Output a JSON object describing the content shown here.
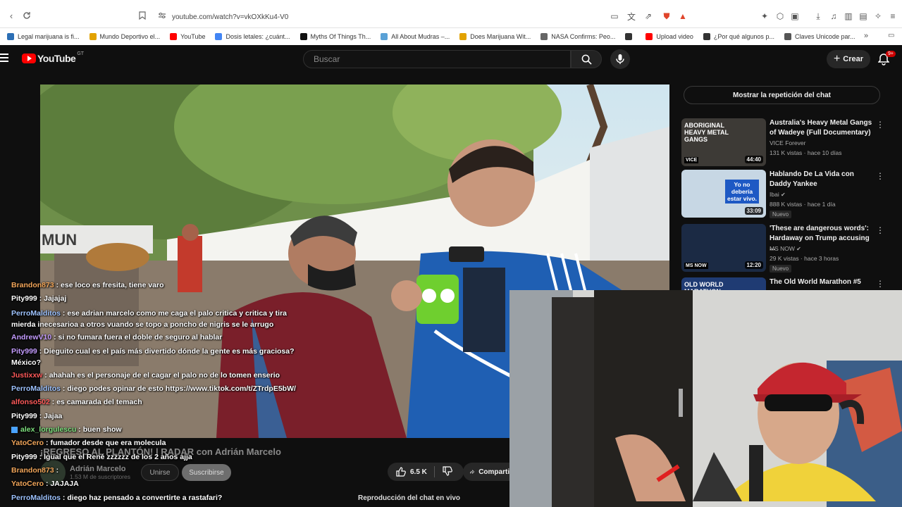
{
  "browser": {
    "url": "youtube.com/watch?v=vkOXkKu4-V0",
    "bookmarks": [
      {
        "label": "Legal marijuana is fi...",
        "color": "#2c6fb5"
      },
      {
        "label": "Mundo Deportivo el...",
        "color": "#e2a200"
      },
      {
        "label": "YouTube",
        "color": "#ff0000"
      },
      {
        "label": "Dosis letales: ¿cuánt...",
        "color": "#4285f4"
      },
      {
        "label": "Myths Of Things Th...",
        "color": "#111111"
      },
      {
        "label": "All About Mudras –...",
        "color": "#5aa1d6"
      },
      {
        "label": "Does Marijuana Wit...",
        "color": "#e2a200"
      },
      {
        "label": "NASA Confirms: Peo...",
        "color": "#666666"
      },
      {
        "label": "",
        "color": "#333333"
      },
      {
        "label": "Upload video",
        "color": "#ff0000"
      },
      {
        "label": "¿Por qué algunos p...",
        "color": "#333333"
      },
      {
        "label": "Claves Unicode par...",
        "color": "#555555"
      }
    ]
  },
  "header": {
    "logo_text": "YouTube",
    "country_code": "GT",
    "search_placeholder": "Buscar",
    "create_label": "Crear",
    "notif_badge": "9+"
  },
  "video": {
    "title": "¡REGRESO AL PLANTÓN! | RADAR con Adrián Marcelo",
    "channel": "Adrián Marcelo",
    "subscribers": "1.53 M de suscriptores",
    "join_label": "Unirse",
    "subscribe_label": "Suscribirse",
    "likes": "6.5 K",
    "share_label": "Compartir",
    "replay_label": "Reproducción del chat en vivo",
    "banner_text": "MUN"
  },
  "chat": [
    {
      "user": "Brandon873",
      "color": "#f2a65a",
      "msg": "ese loco es fresita, tiene varo"
    },
    {
      "user": "Pity999",
      "color": "#ffffff",
      "msg": "Jajajaj"
    },
    {
      "user": "PerroMalditos",
      "color": "#9ec3ff",
      "msg": "ese adrian marcelo como me caga el palo critica y critica y tira mierda inecesarioa a otros vuando se topo a poncho de nigris se le arrugo",
      "wrap": true
    },
    {
      "user": "AndrewV10",
      "color": "#c49cff",
      "msg": "si no fumara fuera el doble de seguro al hablar"
    },
    {
      "user": "Pity999",
      "color": "#c49cff",
      "msg": "Dieguito cual es el país más divertido dónde la gente es más graciosa? México?",
      "wrap": true
    },
    {
      "user": "Justixxw",
      "color": "#ff5a5a",
      "msg": "ahahah es el personaje de el cagar el palo no de lo tomen enserio"
    },
    {
      "user": "PerroMalditos",
      "color": "#9ec3ff",
      "msg": "diego podes opinar de esto https://www.tiktok.com/t/ZTrdpE5bW/"
    },
    {
      "user": "alfonso502",
      "color": "#ff5a5a",
      "msg": "es camarada del temach"
    },
    {
      "user": "Pity999",
      "color": "#ffffff",
      "msg": "Jajaa"
    },
    {
      "user": "alex_lorgulescu",
      "color": "#7ee07e",
      "msg": "buen show",
      "icon": true
    },
    {
      "user": "YatoCero",
      "color": "#f2a65a",
      "msg": "fumador desde que era molecula"
    },
    {
      "user": "Pity999",
      "color": "#ffffff",
      "msg": "Igual que el René zzzzzz de los 2 años ajja"
    },
    {
      "user": "Brandon873",
      "color": "#f2a65a",
      "msg": ""
    },
    {
      "user": "YatoCero",
      "color": "#f2a65a",
      "msg": "JAJAJA"
    },
    {
      "user": "PerroMalditos",
      "color": "#9ec3ff",
      "msg": "diego haz pensado a convertirte a rastafari?"
    }
  ],
  "sidebar": {
    "chat_replay_button": "Mostrar la repetición del chat",
    "recs": [
      {
        "title": "Australia's Heavy Metal Gangs of Wadeye (Full Documentary)",
        "channel": "VICE Forever",
        "verified": false,
        "meta": "131 K vistas · hace 10 días",
        "duration": "44:40",
        "new": "",
        "thumb_text": "ABORIGINAL HEAVY METAL GANGS",
        "thumb_sub": "VICE"
      },
      {
        "title": "Hablando De La Vida con Daddy Yankee",
        "channel": "Ibai",
        "verified": true,
        "meta": "888 K vistas · hace 1 día",
        "duration": "33:09",
        "new": "Nuevo",
        "thumb_text": "Yo no debería estar vivo.",
        "thumb_sub": ""
      },
      {
        "title": "'These are dangerous words': Hardaway on Trump accusing ...",
        "channel": "MS NOW",
        "verified": true,
        "meta": "29 K vistas · hace 3 horas",
        "duration": "12:20",
        "new": "Nuevo",
        "thumb_text": "",
        "thumb_sub": "MS NOW"
      },
      {
        "title": "The Old World Marathon #5",
        "channel": "",
        "verified": false,
        "meta": "",
        "duration": "",
        "new": "",
        "thumb_text": "OLD WORLD MARATHON",
        "thumb_sub": ""
      }
    ]
  }
}
